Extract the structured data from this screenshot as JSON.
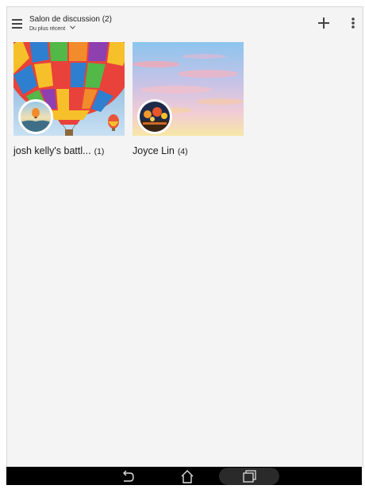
{
  "header": {
    "title": "Salon de discussion (2)",
    "sort_label": "Du plus récent",
    "icons": {
      "menu": "hamburger-icon",
      "sort": "chevron-down-icon",
      "add": "plus-icon",
      "more": "more-vert-icon"
    }
  },
  "chats": [
    {
      "name": "josh kelly's battl...",
      "count": "(1)",
      "thumbnail": "hot-air-balloon-photo",
      "avatar": "balloon-over-valley-photo"
    },
    {
      "name": "Joyce Lin",
      "count": "(4)",
      "thumbnail": "pastel-sunset-sky-photo",
      "avatar": "lantern-street-night-photo"
    }
  ],
  "navbar": {
    "icons": {
      "back": "back-arrow-icon",
      "home": "home-icon",
      "recent": "recent-apps-icon"
    }
  },
  "colors": {
    "background": "#f4f4f4",
    "navbar": "#000000",
    "text": "#1a1a1a"
  }
}
